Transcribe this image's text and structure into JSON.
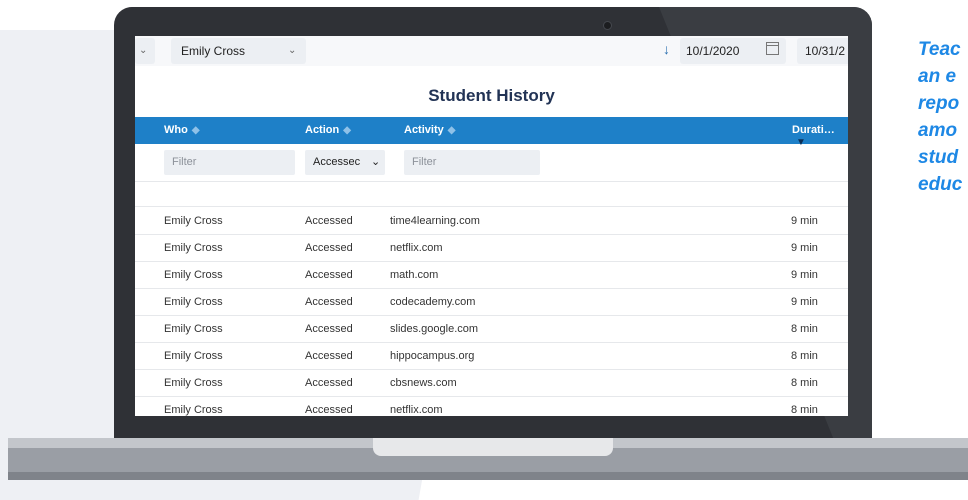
{
  "toolbar": {
    "student_select": "Emily Cross",
    "start_date": "10/1/2020",
    "end_date": "10/31/2"
  },
  "report": {
    "title": "Student History",
    "columns": {
      "who": "Who",
      "action": "Action",
      "activity": "Activity",
      "duration": "Durati…"
    },
    "filters": {
      "who_placeholder": "Filter",
      "action_value": "Accessec",
      "activity_placeholder": "Filter"
    },
    "rows": [
      {
        "who": "Emily Cross",
        "action": "Accessed",
        "activity": "time4learning.com",
        "duration": "9 min"
      },
      {
        "who": "Emily Cross",
        "action": "Accessed",
        "activity": "netflix.com",
        "duration": "9 min"
      },
      {
        "who": "Emily Cross",
        "action": "Accessed",
        "activity": "math.com",
        "duration": "9 min"
      },
      {
        "who": "Emily Cross",
        "action": "Accessed",
        "activity": "codecademy.com",
        "duration": "9 min"
      },
      {
        "who": "Emily Cross",
        "action": "Accessed",
        "activity": "slides.google.com",
        "duration": "8 min"
      },
      {
        "who": "Emily Cross",
        "action": "Accessed",
        "activity": "hippocampus.org",
        "duration": "8 min"
      },
      {
        "who": "Emily Cross",
        "action": "Accessed",
        "activity": "cbsnews.com",
        "duration": "8 min"
      },
      {
        "who": "Emily Cross",
        "action": "Accessed",
        "activity": "netflix.com",
        "duration": "8 min"
      }
    ]
  },
  "side_caption": [
    "Teac",
    "an e",
    "repo",
    "amo",
    "stud",
    "educ"
  ],
  "colors": {
    "header": "#1e80c8",
    "accent_text": "#1e88e5",
    "title": "#223355"
  }
}
